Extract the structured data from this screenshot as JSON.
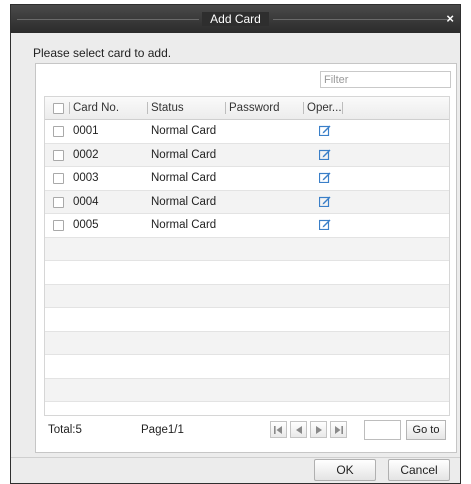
{
  "dialog": {
    "title": "Add Card",
    "close_glyph": "×",
    "prompt": "Please select card to add."
  },
  "filter": {
    "placeholder": "Filter",
    "value": ""
  },
  "table": {
    "columns": [
      "Card No.",
      "Status",
      "Password",
      "Oper..."
    ],
    "rows": [
      {
        "card_no": "0001",
        "status": "Normal Card",
        "password": "",
        "operation_icon": "edit-icon"
      },
      {
        "card_no": "0002",
        "status": "Normal Card",
        "password": "",
        "operation_icon": "edit-icon"
      },
      {
        "card_no": "0003",
        "status": "Normal Card",
        "password": "",
        "operation_icon": "edit-icon"
      },
      {
        "card_no": "0004",
        "status": "Normal Card",
        "password": "",
        "operation_icon": "edit-icon"
      },
      {
        "card_no": "0005",
        "status": "Normal Card",
        "password": "",
        "operation_icon": "edit-icon"
      }
    ]
  },
  "footer": {
    "total": "Total:5",
    "page": "Page1/1",
    "nav_icons": [
      "first-page-icon",
      "prev-page-icon",
      "next-page-icon",
      "last-page-icon"
    ],
    "page_input_value": "",
    "goto_label": "Go to"
  },
  "buttons": {
    "ok": "OK",
    "cancel": "Cancel"
  },
  "colors": {
    "titlebar": "#2e2e2e",
    "edit_icon": "#3a7fc8",
    "alt_row": "#f3f3f3"
  }
}
